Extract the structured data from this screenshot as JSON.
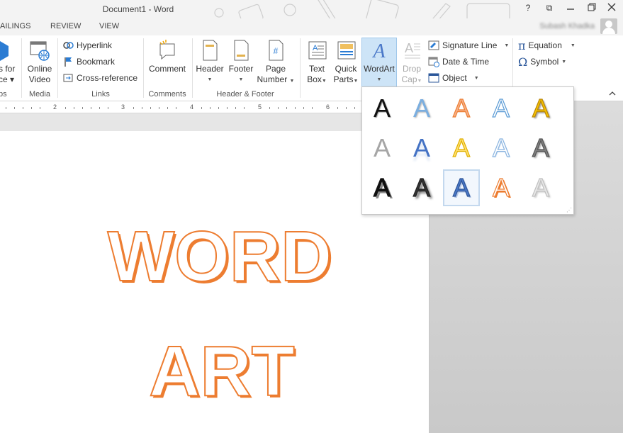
{
  "window": {
    "title": "Document1 - Word",
    "help": "?",
    "ribbon_display": "⧉",
    "restore": "🗗",
    "close": "✕"
  },
  "tabs": [
    "AILINGS",
    "REVIEW",
    "VIEW"
  ],
  "user": {
    "name": "Subash Khadka"
  },
  "ribbon": {
    "addins": {
      "label_line1": "s for",
      "label_line2": "ce ▾",
      "group": "ps"
    },
    "media": {
      "button_line1": "Online",
      "button_line2": "Video",
      "group": "Media"
    },
    "links": {
      "hyperlink": "Hyperlink",
      "bookmark": "Bookmark",
      "cross_reference": "Cross-reference",
      "group": "Links"
    },
    "comments": {
      "comment": "Comment",
      "group": "Comments"
    },
    "header_footer": {
      "header": "Header",
      "footer": "Footer",
      "page_line1": "Page",
      "page_line2": "Number",
      "group": "Header & Footer"
    },
    "text": {
      "textbox_line1": "Text",
      "textbox_line2": "Box",
      "quickparts_line1": "Quick",
      "quickparts_line2": "Parts",
      "wordart": "WordArt",
      "dropcap_line1": "Drop",
      "dropcap_line2": "Cap",
      "signature_line": "Signature Line",
      "date_time": "Date & Time",
      "object": "Object"
    },
    "symbols": {
      "equation": "Equation",
      "symbol": "Symbol",
      "pi": "π",
      "omega": "Ω"
    }
  },
  "ruler": {
    "numbers": [
      "2",
      "3",
      "4",
      "5",
      "6"
    ]
  },
  "document": {
    "line1": "WORD",
    "line2": "ART"
  },
  "gallery": {
    "glyph": "A",
    "styles": [
      {
        "fill": "#111111",
        "stroke": "none",
        "shadow": "1px 1px 1px #999"
      },
      {
        "fill": "#7aaee0",
        "stroke": "none",
        "shadow": "1px 1px 2px #aaa"
      },
      {
        "fill": "#f6b089",
        "stroke": "#ed7d31",
        "shadow": "none"
      },
      {
        "fill": "#ffffff",
        "stroke": "#5b9bd5",
        "shadow": "none"
      },
      {
        "fill": "#f6c200",
        "stroke": "#b8860b",
        "shadow": "2px 2px 2px #999"
      },
      {
        "fill": "#a6a6a6",
        "stroke": "none",
        "shadow": "none"
      },
      {
        "fill": "#4472c4",
        "stroke": "none",
        "shadow": "0 6px 3px #dfe8f4"
      },
      {
        "fill": "#ffe070",
        "stroke": "#e0b000",
        "shadow": "none"
      },
      {
        "fill": "#ffffff",
        "stroke": "#8ab4e0",
        "shadow": "1px 1px 1px #c5d9ef"
      },
      {
        "fill": "#7f7f7f",
        "stroke": "#555555",
        "shadow": "2px 2px 2px #aaa"
      },
      {
        "fill": "#111111",
        "stroke": "#111111",
        "shadow": "3px 3px 0 #888"
      },
      {
        "fill": "#333333",
        "stroke": "#222222",
        "shadow": "3px 3px 3px #666"
      },
      {
        "fill": "#4a78c8",
        "stroke": "#2f5597",
        "shadow": "2px 2px 0 #b4c7e7"
      },
      {
        "fill": "#ffffff",
        "stroke": "#ed7d31",
        "shadow": "2px 2px 0 #ed7d31"
      },
      {
        "fill": "#e8e8e8",
        "stroke": "#bfbfbf",
        "shadow": "2px 2px 2px #ccc"
      }
    ],
    "selected_index": 12
  },
  "colors": {
    "accent_orange": "#ed7d31",
    "ribbon_blue": "#2b579a"
  }
}
